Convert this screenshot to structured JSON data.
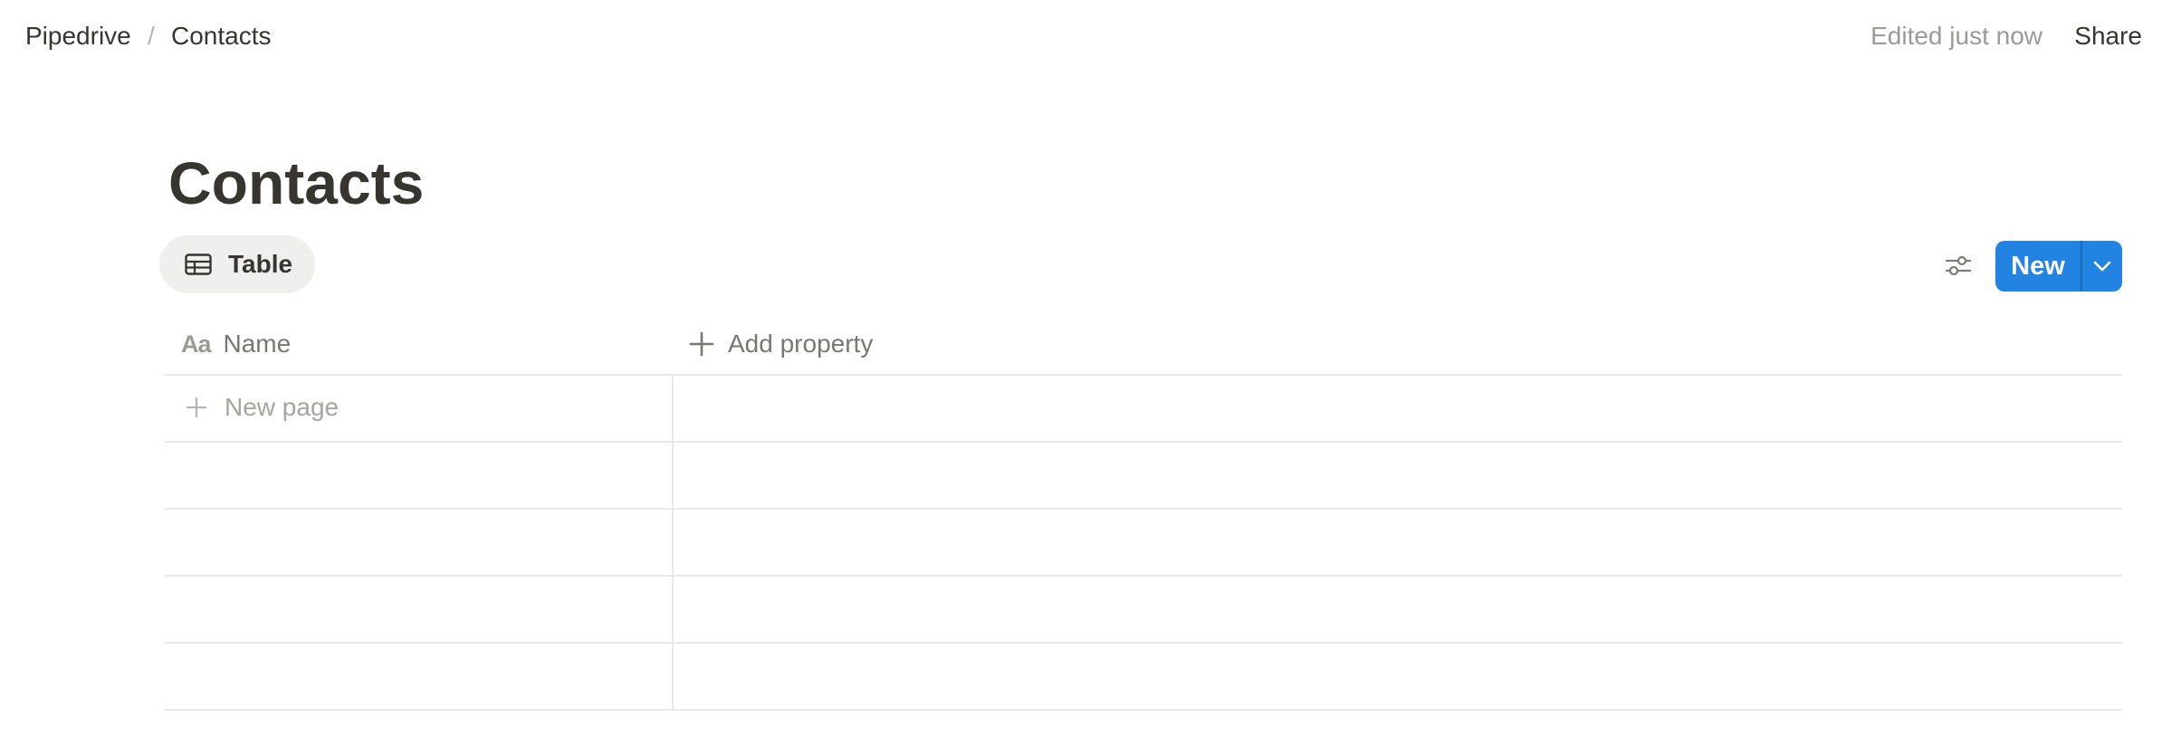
{
  "breadcrumb": {
    "workspace": "Pipedrive",
    "separator": "/",
    "page": "Contacts"
  },
  "header": {
    "edited_status": "Edited just now",
    "share_label": "Share"
  },
  "page": {
    "title": "Contacts"
  },
  "view": {
    "tab_label": "Table",
    "tab_icon": "table-icon",
    "filter_icon": "sliders-icon",
    "new_label": "New",
    "new_caret_icon": "chevron-down-icon",
    "accent_color": "#2383e2"
  },
  "table": {
    "columns": [
      {
        "label": "Name",
        "icon": "Aa"
      }
    ],
    "add_property_label": "Add property",
    "new_page_label": "New page",
    "empty_row_count": 4
  }
}
